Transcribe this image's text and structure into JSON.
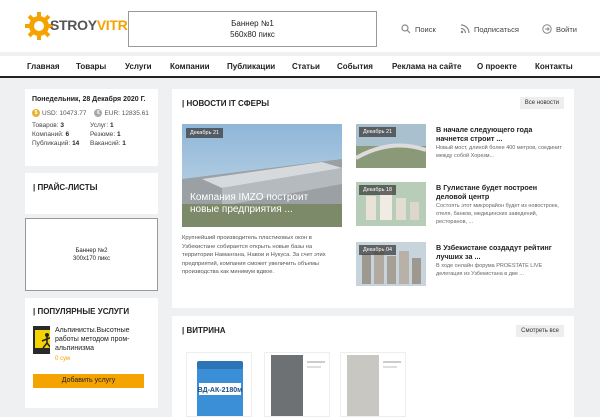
{
  "header": {
    "logo_part1": "STROY",
    "logo_part2": "VITRINA",
    "banner_line1": "Баннер №1",
    "banner_line2": "560x80 пикс",
    "search_label": "Поиск",
    "subscribe_label": "Подписаться",
    "login_label": "Войти"
  },
  "nav": [
    "Главная",
    "Товары",
    "Услуги",
    "Компании",
    "Публикации",
    "Статьи",
    "События",
    "Реклама на сайте",
    "О проекте",
    "Контакты"
  ],
  "sidebar": {
    "date": "Понедельник, 28 Декабря 2020 Г.",
    "usd": "USD: 10473.77",
    "eur": "EUR: 12835.61",
    "stats": [
      {
        "label": "Товаров:",
        "value": "3"
      },
      {
        "label": "Услуг:",
        "value": "1"
      },
      {
        "label": "Компаний:",
        "value": "6"
      },
      {
        "label": "Резюме:",
        "value": "1"
      },
      {
        "label": "Публикаций:",
        "value": "14"
      },
      {
        "label": "Вакансий:",
        "value": "1"
      }
    ],
    "price_lists_title": "| ПРАЙС-ЛИСТЫ",
    "banner2_line1": "Баннер №2",
    "banner2_line2": "300x170 пикс",
    "services_title": "| ПОПУЛЯРНЫЕ УСЛУГИ",
    "service_text": "Альпинисты.Высотные работы методом пром-альпинизма",
    "service_price": "0 сум",
    "add_service_label": "Добавить услугу"
  },
  "news": {
    "title": "| НОВОСТИ IT СФЕРЫ",
    "all_label": "Все новости",
    "main": {
      "date": "Декабрь 21",
      "title": "Компания IMZO построит новые предприятия ...",
      "desc": "Крупнейший производитель пластиковых окон в Узбекистане собирается открыть новые базы на территории Наманганa, Навои и Нукуса. За счет этих предприятий, компания сможет увеличить объемы производства как минимум вдвое."
    },
    "items": [
      {
        "date": "Декабрь 21",
        "title": "В начале следующего года начнется строит ...",
        "desc": "Новый мост, длиной более 400 метров, соединит между собой Хорезм..."
      },
      {
        "date": "Декабрь 18",
        "title": "В Гулистане будет построен деловой центр",
        "desc": "Состоять этот микрорайон будет из новостроек, отеля, банков, медицинских заведений, ресторанов, ..."
      },
      {
        "date": "Декабрь 04",
        "title": "В Узбекистане создадут рейтинг лучших за ...",
        "desc": "В ходе онлайн форума PROESTATE LIVE делегация из Узбекистана в две ..."
      }
    ]
  },
  "vitrina": {
    "title": "| ВИТРИНА",
    "show_all_label": "Смотреть все",
    "product1_label": "ВД-АК-2180м"
  },
  "colors": {
    "accent": "#f5a300",
    "logo_gray": "#555555"
  }
}
